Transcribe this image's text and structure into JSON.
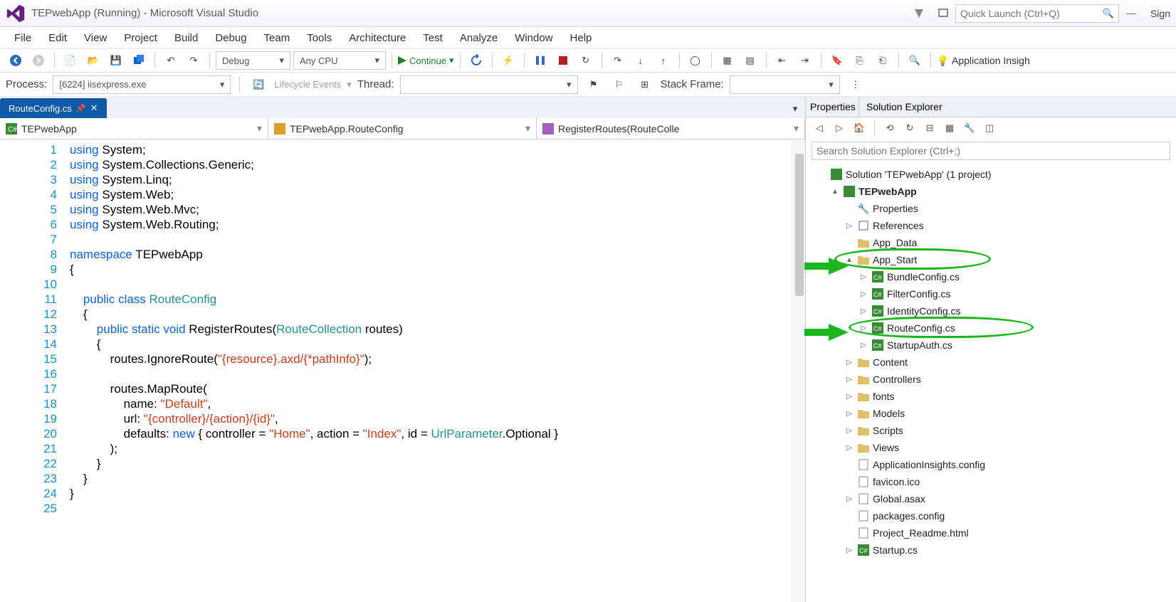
{
  "window": {
    "title": "TEPwebApp (Running) - Microsoft Visual Studio",
    "sign": "Sign"
  },
  "quicklaunch": {
    "placeholder": "Quick Launch (Ctrl+Q)"
  },
  "menu": [
    "File",
    "Edit",
    "View",
    "Project",
    "Build",
    "Debug",
    "Team",
    "Tools",
    "Architecture",
    "Test",
    "Analyze",
    "Window",
    "Help"
  ],
  "toolbar": {
    "config": "Debug",
    "platform": "Any CPU",
    "continue": "Continue",
    "insights": "Application Insigh"
  },
  "debugbar": {
    "process_label": "Process:",
    "process_value": "[6224] iisexpress.exe",
    "lifecycle": "Lifecycle Events",
    "thread_label": "Thread:",
    "stack_label": "Stack Frame:"
  },
  "tab": {
    "name": "RouteConfig.cs"
  },
  "crumbs": {
    "ns": "TEPwebApp",
    "class": "TEPwebApp.RouteConfig",
    "method": "RegisterRoutes(RouteColle"
  },
  "code_lines": [
    {
      "n": 1,
      "h": "<span class='kw'>using</span> System;"
    },
    {
      "n": 2,
      "h": "<span class='kw'>using</span> System.Collections.Generic;"
    },
    {
      "n": 3,
      "h": "<span class='kw'>using</span> System.Linq;"
    },
    {
      "n": 4,
      "h": "<span class='kw'>using</span> System.Web;"
    },
    {
      "n": 5,
      "h": "<span class='kw'>using</span> System.Web.Mvc;"
    },
    {
      "n": 6,
      "h": "<span class='kw'>using</span> System.Web.Routing;"
    },
    {
      "n": 7,
      "h": ""
    },
    {
      "n": 8,
      "h": "<span class='kw'>namespace</span> TEPwebApp"
    },
    {
      "n": 9,
      "h": "{"
    },
    {
      "n": 10,
      "h": ""
    },
    {
      "n": 11,
      "h": "    <span class='kw'>public</span> <span class='kw'>class</span> <span class='typ'>RouteConfig</span>"
    },
    {
      "n": 12,
      "h": "    {"
    },
    {
      "n": 13,
      "h": "        <span class='kw'>public</span> <span class='kw'>static</span> <span class='kw'>void</span> RegisterRoutes(<span class='typ'>RouteCollection</span> routes)"
    },
    {
      "n": 14,
      "h": "        {"
    },
    {
      "n": 15,
      "h": "            routes.IgnoreRoute(<span class='str'>\"{resource}.axd/{*pathInfo}\"</span>);"
    },
    {
      "n": 16,
      "h": ""
    },
    {
      "n": 17,
      "h": "            routes.MapRoute("
    },
    {
      "n": 18,
      "h": "                name: <span class='str'>\"Default\"</span>,"
    },
    {
      "n": 19,
      "h": "                url: <span class='str'>\"{controller}/{action}/{id}\"</span>,"
    },
    {
      "n": 20,
      "h": "                defaults: <span class='kw'>new</span> { controller = <span class='str'>\"Home\"</span>, action = <span class='str'>\"Index\"</span>, id = <span class='typ'>UrlParameter</span>.Optional }"
    },
    {
      "n": 21,
      "h": "            );"
    },
    {
      "n": 22,
      "h": "        }"
    },
    {
      "n": 23,
      "h": "    }"
    },
    {
      "n": 24,
      "h": "}"
    },
    {
      "n": 25,
      "h": ""
    }
  ],
  "panels": {
    "properties": "Properties",
    "solution": "Solution Explorer"
  },
  "se_search": {
    "placeholder": "Search Solution Explorer (Ctrl+;)"
  },
  "tree": {
    "solution": "Solution 'TEPwebApp' (1 project)",
    "project": "TEPwebApp",
    "items": [
      {
        "ind": 3,
        "exp": "",
        "icon": "wrench",
        "label": "Properties"
      },
      {
        "ind": 3,
        "exp": "▷",
        "icon": "ref",
        "label": "References"
      },
      {
        "ind": 3,
        "exp": "",
        "icon": "folder",
        "label": "App_Data"
      },
      {
        "ind": 3,
        "exp": "▲",
        "icon": "folder",
        "label": "App_Start",
        "hl": true,
        "arrow": true
      },
      {
        "ind": 4,
        "exp": "▷",
        "icon": "cs",
        "label": "BundleConfig.cs"
      },
      {
        "ind": 4,
        "exp": "▷",
        "icon": "cs",
        "label": "FilterConfig.cs"
      },
      {
        "ind": 4,
        "exp": "▷",
        "icon": "cs",
        "label": "IdentityConfig.cs"
      },
      {
        "ind": 4,
        "exp": "▷",
        "icon": "cs",
        "label": "RouteConfig.cs",
        "hl": true,
        "arrow": true
      },
      {
        "ind": 4,
        "exp": "▷",
        "icon": "cs",
        "label": "StartupAuth.cs"
      },
      {
        "ind": 3,
        "exp": "▷",
        "icon": "folder",
        "label": "Content"
      },
      {
        "ind": 3,
        "exp": "▷",
        "icon": "folder",
        "label": "Controllers"
      },
      {
        "ind": 3,
        "exp": "▷",
        "icon": "folder",
        "label": "fonts"
      },
      {
        "ind": 3,
        "exp": "▷",
        "icon": "folder",
        "label": "Models"
      },
      {
        "ind": 3,
        "exp": "▷",
        "icon": "folder",
        "label": "Scripts"
      },
      {
        "ind": 3,
        "exp": "▷",
        "icon": "folder",
        "label": "Views"
      },
      {
        "ind": 3,
        "exp": "",
        "icon": "file",
        "label": "ApplicationInsights.config"
      },
      {
        "ind": 3,
        "exp": "",
        "icon": "file",
        "label": "favicon.ico"
      },
      {
        "ind": 3,
        "exp": "▷",
        "icon": "file",
        "label": "Global.asax"
      },
      {
        "ind": 3,
        "exp": "",
        "icon": "file",
        "label": "packages.config"
      },
      {
        "ind": 3,
        "exp": "",
        "icon": "file",
        "label": "Project_Readme.html"
      },
      {
        "ind": 3,
        "exp": "▷",
        "icon": "cs",
        "label": "Startup.cs"
      }
    ]
  }
}
